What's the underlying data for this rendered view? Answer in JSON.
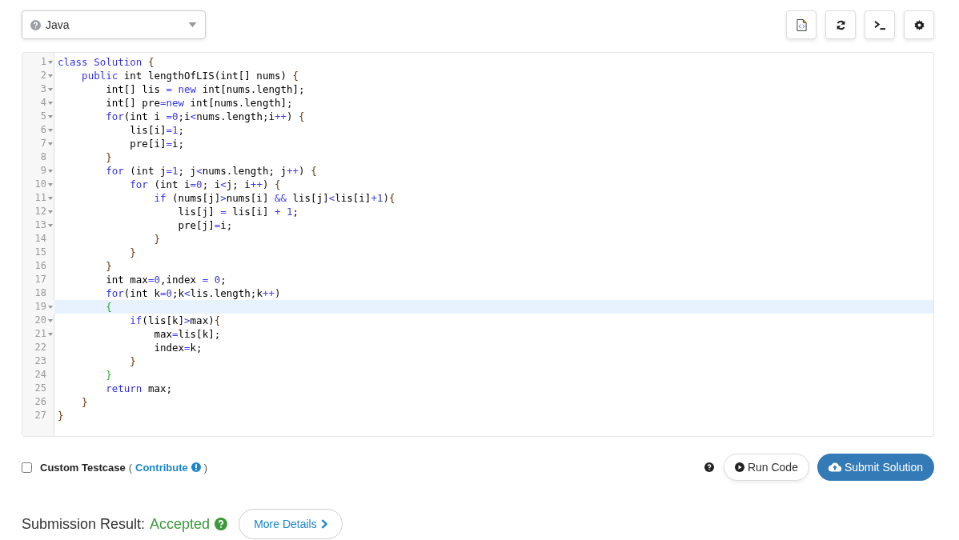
{
  "language_select": {
    "value": "Java"
  },
  "toolbar": [
    {
      "kind": "file"
    },
    {
      "kind": "reset"
    },
    {
      "kind": "console"
    },
    {
      "kind": "settings"
    }
  ],
  "editor": {
    "lines": [
      {
        "number": "1",
        "fold": true,
        "highlighted": false,
        "tokens": [
          {
            "text": "class ",
            "kind": "keyword"
          },
          {
            "text": "Solution ",
            "kind": "keyword"
          },
          {
            "text": "{",
            "kind": "bracket"
          }
        ]
      },
      {
        "number": "2",
        "fold": true,
        "highlighted": false,
        "tokens": [
          {
            "text": "    public",
            "kind": "keyword"
          },
          {
            "text": " int lengthOfLIS(int[] nums) ",
            "kind": "plain"
          },
          {
            "text": "{",
            "kind": "bracket"
          }
        ]
      },
      {
        "number": "3",
        "fold": true,
        "highlighted": false,
        "tokens": [
          {
            "text": "        int[] lis ",
            "kind": "plain"
          },
          {
            "text": "=",
            "kind": "operator"
          },
          {
            "text": " new",
            "kind": "keyword"
          },
          {
            "text": " int[nums.length];",
            "kind": "plain"
          }
        ]
      },
      {
        "number": "4",
        "fold": true,
        "highlighted": false,
        "tokens": [
          {
            "text": "        int[] pre",
            "kind": "plain"
          },
          {
            "text": "=",
            "kind": "operator"
          },
          {
            "text": "new",
            "kind": "keyword"
          },
          {
            "text": " int[nums.length];",
            "kind": "plain"
          }
        ]
      },
      {
        "number": "5",
        "fold": true,
        "highlighted": false,
        "tokens": [
          {
            "text": "        for",
            "kind": "keyword"
          },
          {
            "text": "(int i ",
            "kind": "plain"
          },
          {
            "text": "=",
            "kind": "operator"
          },
          {
            "text": "0",
            "kind": "number"
          },
          {
            "text": ";i",
            "kind": "plain"
          },
          {
            "text": "<",
            "kind": "operator"
          },
          {
            "text": "nums.length;i",
            "kind": "plain"
          },
          {
            "text": "++",
            "kind": "operator"
          },
          {
            "text": ") ",
            "kind": "plain"
          },
          {
            "text": "{",
            "kind": "bracket"
          }
        ]
      },
      {
        "number": "6",
        "fold": true,
        "highlighted": false,
        "tokens": [
          {
            "text": "            lis[i]",
            "kind": "plain"
          },
          {
            "text": "=",
            "kind": "operator"
          },
          {
            "text": "1",
            "kind": "number"
          },
          {
            "text": ";",
            "kind": "plain"
          }
        ]
      },
      {
        "number": "7",
        "fold": true,
        "highlighted": false,
        "tokens": [
          {
            "text": "            pre[i]",
            "kind": "plain"
          },
          {
            "text": "=",
            "kind": "operator"
          },
          {
            "text": "i;",
            "kind": "plain"
          }
        ]
      },
      {
        "number": "8",
        "fold": false,
        "highlighted": false,
        "tokens": [
          {
            "text": "        }",
            "kind": "bracket"
          }
        ]
      },
      {
        "number": "9",
        "fold": true,
        "highlighted": false,
        "tokens": [
          {
            "text": "        for",
            "kind": "keyword"
          },
          {
            "text": " (int j",
            "kind": "plain"
          },
          {
            "text": "=",
            "kind": "operator"
          },
          {
            "text": "1",
            "kind": "number"
          },
          {
            "text": "; j",
            "kind": "plain"
          },
          {
            "text": "<",
            "kind": "operator"
          },
          {
            "text": "nums.length; j",
            "kind": "plain"
          },
          {
            "text": "++",
            "kind": "operator"
          },
          {
            "text": ") ",
            "kind": "plain"
          },
          {
            "text": "{",
            "kind": "bracket"
          }
        ]
      },
      {
        "number": "10",
        "fold": true,
        "highlighted": false,
        "tokens": [
          {
            "text": "            for",
            "kind": "keyword"
          },
          {
            "text": " (int i",
            "kind": "plain"
          },
          {
            "text": "=",
            "kind": "operator"
          },
          {
            "text": "0",
            "kind": "number"
          },
          {
            "text": "; i",
            "kind": "plain"
          },
          {
            "text": "<",
            "kind": "operator"
          },
          {
            "text": "j; i",
            "kind": "plain"
          },
          {
            "text": "++",
            "kind": "operator"
          },
          {
            "text": ") ",
            "kind": "plain"
          },
          {
            "text": "{",
            "kind": "bracket"
          }
        ]
      },
      {
        "number": "11",
        "fold": true,
        "highlighted": false,
        "tokens": [
          {
            "text": "                if",
            "kind": "keyword"
          },
          {
            "text": " (nums[j]",
            "kind": "plain"
          },
          {
            "text": ">",
            "kind": "operator"
          },
          {
            "text": "nums[i] ",
            "kind": "plain"
          },
          {
            "text": "&&",
            "kind": "operator"
          },
          {
            "text": " lis[j]",
            "kind": "plain"
          },
          {
            "text": "<",
            "kind": "operator"
          },
          {
            "text": "lis[i]",
            "kind": "plain"
          },
          {
            "text": "+",
            "kind": "operator"
          },
          {
            "text": "1",
            "kind": "number"
          },
          {
            "text": ")",
            "kind": "plain"
          },
          {
            "text": "{",
            "kind": "bracket"
          }
        ]
      },
      {
        "number": "12",
        "fold": true,
        "highlighted": false,
        "tokens": [
          {
            "text": "                    lis[j] ",
            "kind": "plain"
          },
          {
            "text": "=",
            "kind": "operator"
          },
          {
            "text": " lis[i] ",
            "kind": "plain"
          },
          {
            "text": "+",
            "kind": "operator"
          },
          {
            "text": " 1",
            "kind": "number"
          },
          {
            "text": ";",
            "kind": "plain"
          }
        ]
      },
      {
        "number": "13",
        "fold": true,
        "highlighted": false,
        "tokens": [
          {
            "text": "                    pre[j]",
            "kind": "plain"
          },
          {
            "text": "=",
            "kind": "operator"
          },
          {
            "text": "i;",
            "kind": "plain"
          }
        ]
      },
      {
        "number": "14",
        "fold": false,
        "highlighted": false,
        "tokens": [
          {
            "text": "                }",
            "kind": "bracket"
          }
        ]
      },
      {
        "number": "15",
        "fold": false,
        "highlighted": false,
        "tokens": [
          {
            "text": "            }",
            "kind": "bracket"
          }
        ]
      },
      {
        "number": "16",
        "fold": false,
        "highlighted": false,
        "tokens": [
          {
            "text": "        }",
            "kind": "bracket"
          }
        ]
      },
      {
        "number": "17",
        "fold": false,
        "highlighted": false,
        "tokens": [
          {
            "text": "        int max",
            "kind": "plain"
          },
          {
            "text": "=",
            "kind": "operator"
          },
          {
            "text": "0",
            "kind": "number"
          },
          {
            "text": ",index ",
            "kind": "plain"
          },
          {
            "text": "=",
            "kind": "operator"
          },
          {
            "text": " 0",
            "kind": "number"
          },
          {
            "text": ";",
            "kind": "plain"
          }
        ]
      },
      {
        "number": "18",
        "fold": false,
        "highlighted": false,
        "tokens": [
          {
            "text": "        for",
            "kind": "keyword"
          },
          {
            "text": "(int k",
            "kind": "plain"
          },
          {
            "text": "=",
            "kind": "operator"
          },
          {
            "text": "0",
            "kind": "number"
          },
          {
            "text": ";k",
            "kind": "plain"
          },
          {
            "text": "<",
            "kind": "operator"
          },
          {
            "text": "lis.length;k",
            "kind": "plain"
          },
          {
            "text": "++",
            "kind": "operator"
          },
          {
            "text": ")",
            "kind": "plain"
          }
        ]
      },
      {
        "number": "19",
        "fold": true,
        "highlighted": true,
        "tokens": [
          {
            "text": "        {",
            "kind": "matched"
          }
        ]
      },
      {
        "number": "20",
        "fold": true,
        "highlighted": false,
        "tokens": [
          {
            "text": "            if",
            "kind": "keyword"
          },
          {
            "text": "(lis[k]",
            "kind": "plain"
          },
          {
            "text": ">",
            "kind": "operator"
          },
          {
            "text": "max)",
            "kind": "plain"
          },
          {
            "text": "{",
            "kind": "bracket"
          }
        ]
      },
      {
        "number": "21",
        "fold": true,
        "highlighted": false,
        "tokens": [
          {
            "text": "                max",
            "kind": "plain"
          },
          {
            "text": "=",
            "kind": "operator"
          },
          {
            "text": "lis[k];",
            "kind": "plain"
          }
        ]
      },
      {
        "number": "22",
        "fold": false,
        "highlighted": false,
        "tokens": [
          {
            "text": "                index",
            "kind": "plain"
          },
          {
            "text": "=",
            "kind": "operator"
          },
          {
            "text": "k;",
            "kind": "plain"
          }
        ]
      },
      {
        "number": "23",
        "fold": false,
        "highlighted": false,
        "tokens": [
          {
            "text": "            }",
            "kind": "bracket"
          }
        ]
      },
      {
        "number": "24",
        "fold": false,
        "highlighted": false,
        "tokens": [
          {
            "text": "        }",
            "kind": "matched"
          }
        ]
      },
      {
        "number": "25",
        "fold": false,
        "highlighted": false,
        "tokens": [
          {
            "text": "        return",
            "kind": "keyword"
          },
          {
            "text": " max;",
            "kind": "plain"
          }
        ]
      },
      {
        "number": "26",
        "fold": false,
        "highlighted": false,
        "tokens": [
          {
            "text": "    }",
            "kind": "bracket"
          }
        ]
      },
      {
        "number": "27",
        "fold": false,
        "highlighted": false,
        "tokens": [
          {
            "text": "}",
            "kind": "bracket"
          }
        ]
      }
    ]
  },
  "custom_testcase": {
    "checked": false,
    "label": "Custom Testcase",
    "open_paren": "(",
    "link": "Contribute",
    "close_paren": ")"
  },
  "actions": {
    "run": "Run Code",
    "submit": "Submit Solution"
  },
  "result": {
    "label": "Submission Result:",
    "status": "Accepted",
    "details": "More Details"
  }
}
